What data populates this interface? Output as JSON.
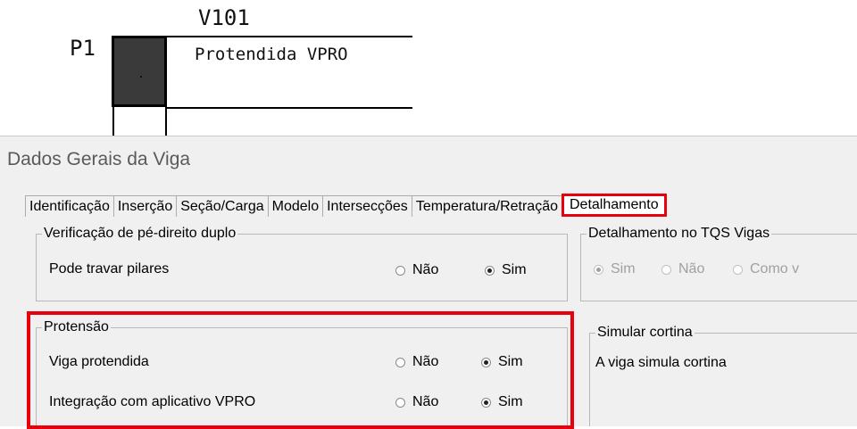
{
  "cad": {
    "beam_name": "V101",
    "pillar_name": "P1",
    "beam_description": "Protendida VPRO"
  },
  "dialog": {
    "title": "Dados Gerais da Viga",
    "tabs": [
      {
        "label": "Identificação"
      },
      {
        "label": "Inserção"
      },
      {
        "label": "Seção/Carga"
      },
      {
        "label": "Modelo"
      },
      {
        "label": "Intersecções"
      },
      {
        "label": "Temperatura/Retração"
      },
      {
        "label": "Detalhamento",
        "active": true
      }
    ],
    "verificacao": {
      "title": "Verificação de pé-direito duplo",
      "row_label": "Pode travar pilares",
      "opt_nao": "Não",
      "opt_sim": "Sim",
      "selected": "Sim"
    },
    "detalhamento_tqs": {
      "title": "Detalhamento no TQS Vigas",
      "opt_sim": "Sim",
      "opt_nao": "Não",
      "opt_como": "Como v",
      "selected": "Sim",
      "disabled": true
    },
    "protensao": {
      "title": "Protensão",
      "row1_label": "Viga protendida",
      "row2_label": "Integração com aplicativo VPRO",
      "opt_nao": "Não",
      "opt_sim": "Sim",
      "row1_selected": "Sim",
      "row2_selected": "Sim"
    },
    "cortina": {
      "title": "Simular cortina",
      "text": "A viga simula cortina"
    }
  },
  "colors": {
    "highlight": "#e8000b",
    "dialog_bg": "#f0f0f0"
  }
}
